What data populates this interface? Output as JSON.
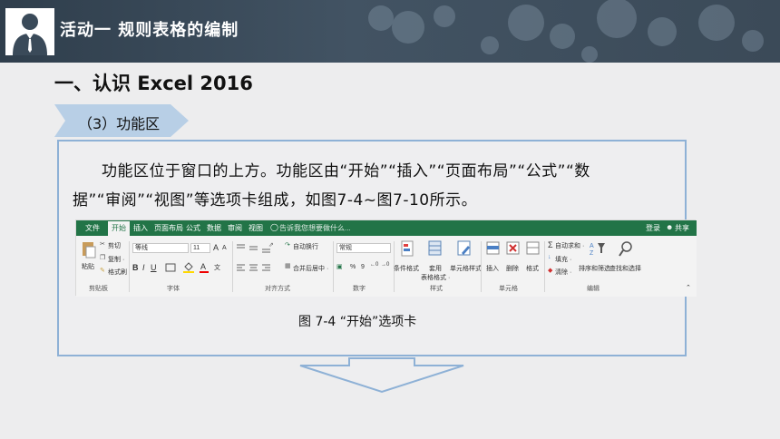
{
  "header": {
    "title": "活动一  规则表格的编制"
  },
  "section": {
    "title": "一、认识 Excel 2016"
  },
  "tag": {
    "label": "（3）功能区"
  },
  "body": {
    "para1": "功能区位于窗口的上方。功能区由“开始”“插入”“页面布局”“公式”“数",
    "para2": "据”“审阅”“视图”等选项卡组成，如图7-4~图7-10所示。"
  },
  "ribbon": {
    "tabs": [
      "文件",
      "开始",
      "插入",
      "页面布局",
      "公式",
      "数据",
      "审阅",
      "视图"
    ],
    "tell_me": "告诉我您想要做什么...",
    "login": "登录",
    "share": "共享",
    "clipboard": {
      "paste": "粘贴",
      "cut": "剪切",
      "copy": "复制 ·",
      "format_painter": "格式刷",
      "group": "剪贴板"
    },
    "font": {
      "name": "等线",
      "size": "11",
      "grow": "A",
      "shrink": "A",
      "bold": "B",
      "italic": "I",
      "underline": "U",
      "group": "字体"
    },
    "alignment": {
      "wrap": "自动换行",
      "merge": "合并后居中 ·",
      "group": "对齐方式"
    },
    "number": {
      "format": "常规",
      "percent": "%",
      "comma": "9",
      "group": "数字"
    },
    "styles": {
      "conditional": "条件格式",
      "table": "套用",
      "table2": "表格格式 ·",
      "cell": "单元格样式",
      "group": "样式"
    },
    "cells": {
      "insert": "插入",
      "delete": "删除",
      "format": "格式",
      "group": "单元格"
    },
    "editing": {
      "autosum": "自动求和 ·",
      "fill": "填充 ·",
      "clear": "清除 ·",
      "sort": "排序和筛选",
      "find": "查找和选择",
      "group": "编辑"
    }
  },
  "caption": "图 7-4 “开始”选项卡",
  "colors": {
    "header": "#3a4a59",
    "box_border": "#8eb1d6",
    "tag": "#b8cfe6",
    "excel_green": "#227447"
  }
}
